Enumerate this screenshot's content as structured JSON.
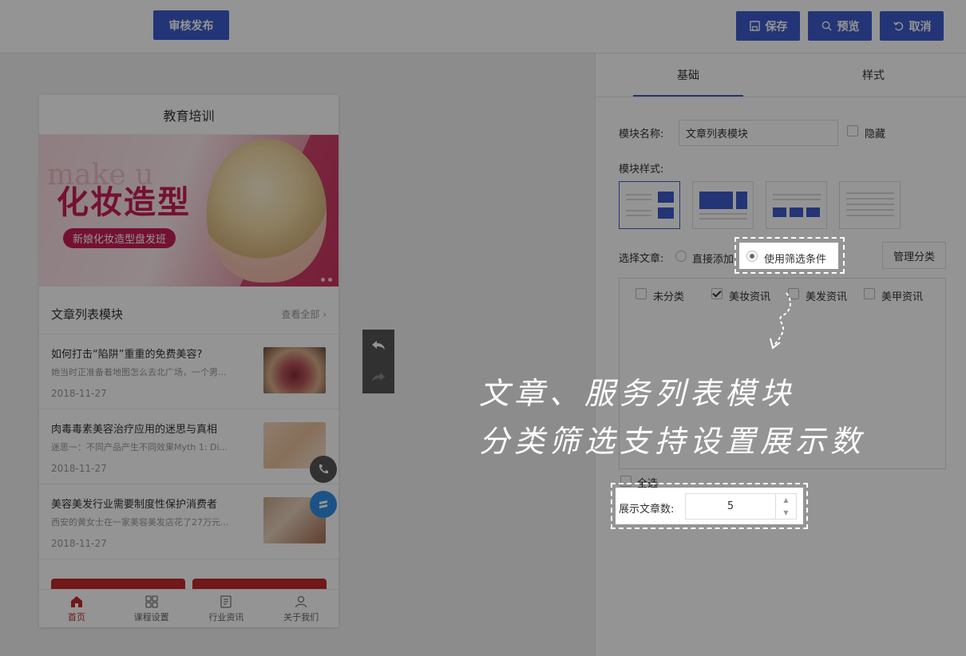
{
  "toolbar": {
    "publish_label": "审核发布",
    "save_label": "保存",
    "preview_label": "预览",
    "cancel_label": "取消"
  },
  "phone": {
    "title": "教育培训",
    "banner": {
      "ghost_text": "make u",
      "headline": "化妆造型",
      "pill": "新娘化妆造型盘发班"
    },
    "module_title": "文章列表模块",
    "module_more": "查看全部",
    "articles": [
      {
        "title": "如何打击“陷阱”重重的免费美容?",
        "desc": "她当时正准备着地图怎么去北广场，一个男...",
        "date": "2018-11-27"
      },
      {
        "title": "肉毒毒素美容治疗应用的迷思与真相",
        "desc": "迷思一：不同产品产生不同效果Myth 1: Di...",
        "date": "2018-11-27"
      },
      {
        "title": "美容美发行业需要制度性保护消费者",
        "desc": "西安的黄女士在一家美容美发店花了27万元...",
        "date": "2018-11-27"
      }
    ],
    "tabs": [
      {
        "label": "首页",
        "icon": "home-icon"
      },
      {
        "label": "课程设置",
        "icon": "grid-icon"
      },
      {
        "label": "行业资讯",
        "icon": "document-icon"
      },
      {
        "label": "关于我们",
        "icon": "user-icon"
      }
    ]
  },
  "panel": {
    "tabs": [
      "基础",
      "样式"
    ],
    "module_name_label": "模块名称:",
    "module_name_value": "文章列表模块",
    "hide_label": "隐藏",
    "module_style_label": "模块样式:",
    "select_article_label": "选择文章:",
    "direct_add_label": "直接添加",
    "use_filter_label": "使用筛选条件",
    "manage_category_label": "管理分类",
    "categories": [
      {
        "label": "未分类",
        "checked": false
      },
      {
        "label": "美妆资讯",
        "checked": true
      },
      {
        "label": "美发资讯",
        "checked": false
      },
      {
        "label": "美甲资讯",
        "checked": false
      }
    ],
    "select_all_label": "全选",
    "show_count_label": "展示文章数:",
    "show_count_value": "5"
  },
  "annotation": {
    "line1": "文章、服务列表模块",
    "line2": "分类筛选支持设置展示数"
  },
  "colors": {
    "primary": "#3d5ccb",
    "brand_red": "#c32a2a",
    "banner_pink": "#c81e57",
    "service_blue": "#2f8fe8"
  }
}
